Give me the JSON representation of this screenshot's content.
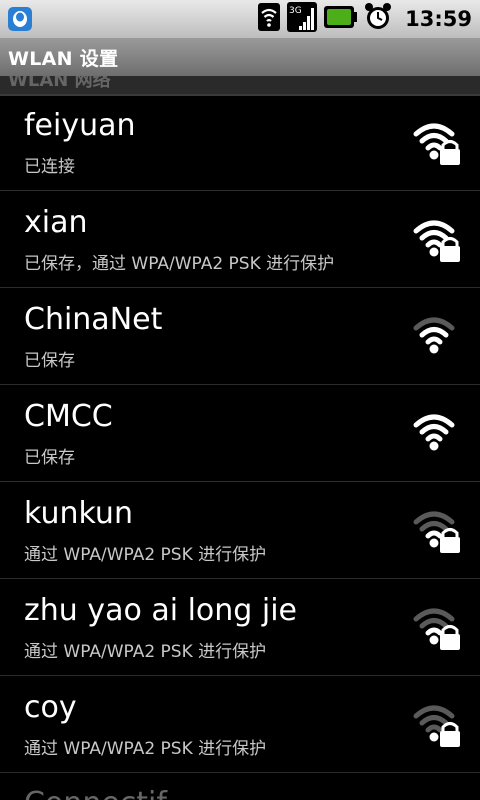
{
  "status_bar": {
    "time": "13:59",
    "icons": [
      "qq-icon",
      "wifi-icon",
      "3g-signal-icon",
      "battery-icon",
      "alarm-icon"
    ],
    "network_label": "3G"
  },
  "title_bar": {
    "title": "WLAN 设置"
  },
  "section_header": {
    "label": "WLAN 网络"
  },
  "networks": [
    {
      "ssid": "feiyuan",
      "status": "已连接",
      "secured": true,
      "level": 4
    },
    {
      "ssid": "xian",
      "status": "已保存，通过 WPA/WPA2 PSK 进行保护",
      "secured": true,
      "level": 4
    },
    {
      "ssid": "ChinaNet",
      "status": "已保存",
      "secured": false,
      "level": 3
    },
    {
      "ssid": "CMCC",
      "status": "已保存",
      "secured": false,
      "level": 4
    },
    {
      "ssid": "kunkun",
      "status": "通过 WPA/WPA2 PSK 进行保护",
      "secured": true,
      "level": 2
    },
    {
      "ssid": "zhu yao ai long jie",
      "status": "通过 WPA/WPA2 PSK 进行保护",
      "secured": true,
      "level": 2
    },
    {
      "ssid": "coy",
      "status": "通过 WPA/WPA2 PSK 进行保护",
      "secured": true,
      "level": 1
    }
  ],
  "partial_item": {
    "label": "Connectif"
  },
  "colors": {
    "active_signal": "#ffffff",
    "inactive_signal": "#5a5a5a",
    "battery": "#4caf1a"
  }
}
